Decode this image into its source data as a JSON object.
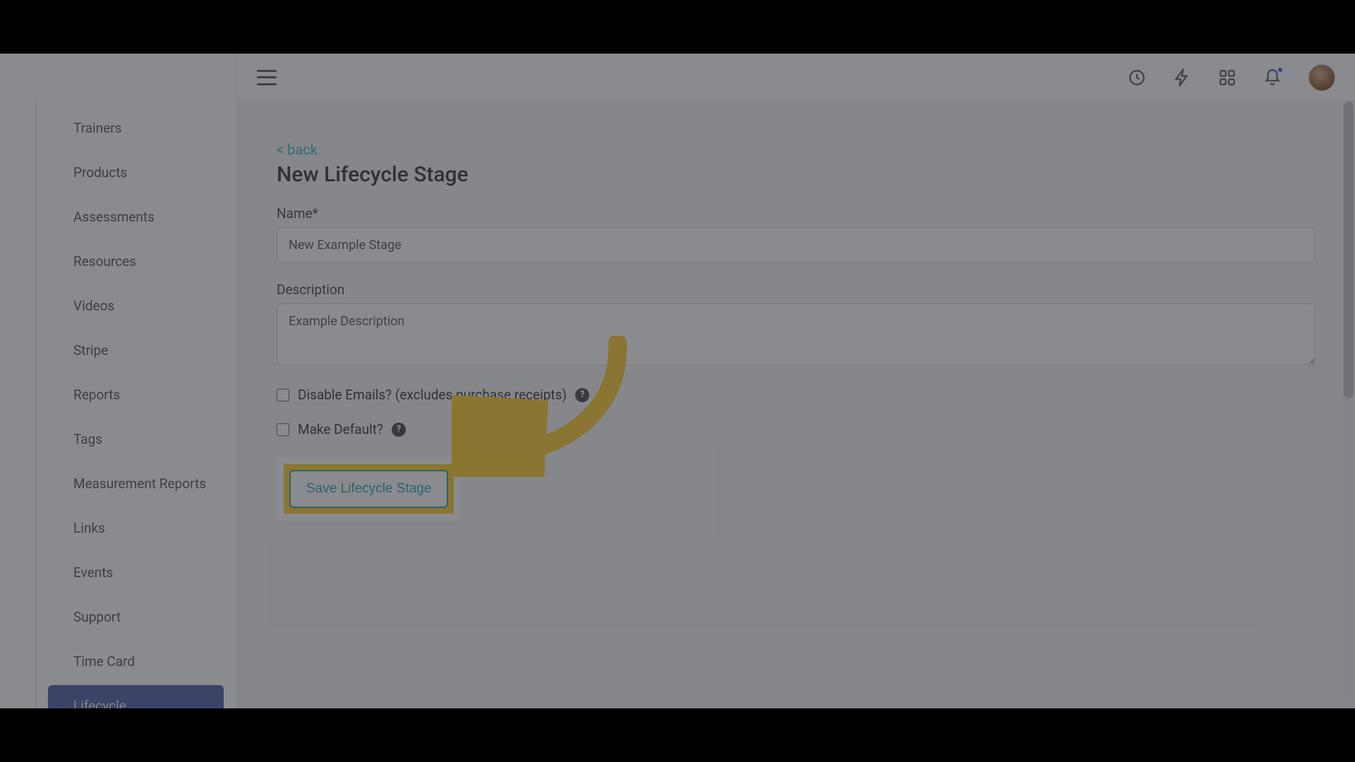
{
  "sidebar": {
    "items": [
      {
        "label": "Trainers",
        "active": false
      },
      {
        "label": "Products",
        "active": false
      },
      {
        "label": "Assessments",
        "active": false
      },
      {
        "label": "Resources",
        "active": false
      },
      {
        "label": "Videos",
        "active": false
      },
      {
        "label": "Stripe",
        "active": false
      },
      {
        "label": "Reports",
        "active": false
      },
      {
        "label": "Tags",
        "active": false
      },
      {
        "label": "Measurement Reports",
        "active": false
      },
      {
        "label": "Links",
        "active": false
      },
      {
        "label": "Events",
        "active": false
      },
      {
        "label": "Support",
        "active": false
      },
      {
        "label": "Time Card",
        "active": false
      },
      {
        "label": "Lifecycle",
        "active": true
      }
    ]
  },
  "topbar": {
    "icons": [
      "clock-icon",
      "flash-icon",
      "apps-icon",
      "bell-icon"
    ],
    "has_notification_dot": true
  },
  "main": {
    "back_text": "< back",
    "title": "New Lifecycle Stage",
    "name_label": "Name*",
    "name_value": "New Example Stage",
    "description_label": "Description",
    "description_value": "Example Description",
    "disable_emails_label": "Disable Emails? (excludes purchase receipts)",
    "disable_emails_checked": false,
    "make_default_label": "Make Default?",
    "make_default_checked": false,
    "save_label": "Save Lifecycle Stage",
    "help_glyph": "?"
  },
  "annotation": {
    "highlight_color": "#ffd23f"
  }
}
